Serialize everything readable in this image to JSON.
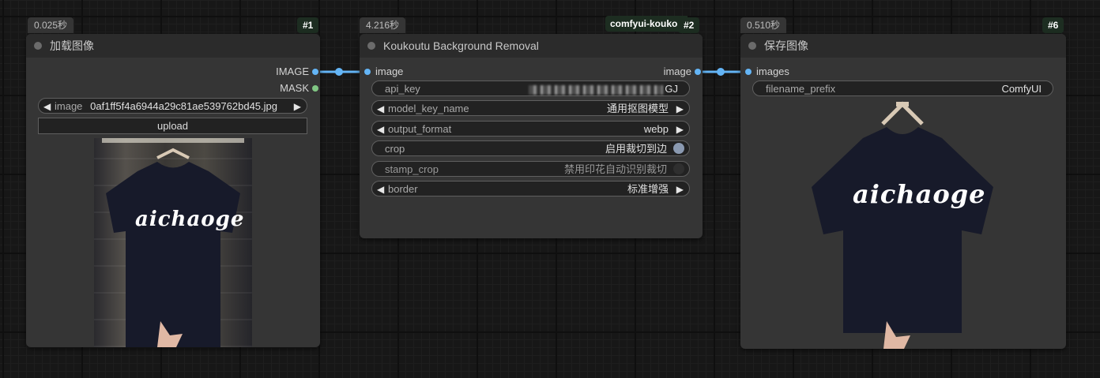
{
  "colors": {
    "image_link": "#64b5f6",
    "mask_link": "#81c784",
    "node_bg": "#353535",
    "title_bg": "#2b2b2b",
    "id_badge_bg": "#1d2d21"
  },
  "nodes": {
    "load_image": {
      "time": "0.025秒",
      "id": "#1",
      "title": "加载图像",
      "outputs": [
        "IMAGE",
        "MASK"
      ],
      "image_widget": {
        "name": "image",
        "value": "0af1ff5f4a6944a29c81ae539762bd45.jpg"
      },
      "upload_label": "upload",
      "preview_text": "aichaoge"
    },
    "koukoutu": {
      "time": "4.216秒",
      "group": "comfyui-kouko",
      "id": "#2",
      "title": "Koukoutu Background Removal",
      "input": "image",
      "output": "image",
      "widgets": {
        "api_key": {
          "name": "api_key",
          "value_suffix": "GJ"
        },
        "model_key_name": {
          "name": "model_key_name",
          "value": "通用抠图模型"
        },
        "output_format": {
          "name": "output_format",
          "value": "webp"
        },
        "crop": {
          "name": "crop",
          "value": "启用裁切到边",
          "on": true
        },
        "stamp_crop": {
          "name": "stamp_crop",
          "value": "禁用印花自动识别裁切",
          "on": false
        },
        "border": {
          "name": "border",
          "value": "标准增强"
        }
      }
    },
    "save_image": {
      "time": "0.510秒",
      "id": "#6",
      "title": "保存图像",
      "input": "images",
      "filename_prefix": {
        "name": "filename_prefix",
        "value": "ComfyUI"
      },
      "preview_text": "aichaoge"
    }
  },
  "icons": {
    "arrow_left": "◀",
    "arrow_right": "▶"
  }
}
